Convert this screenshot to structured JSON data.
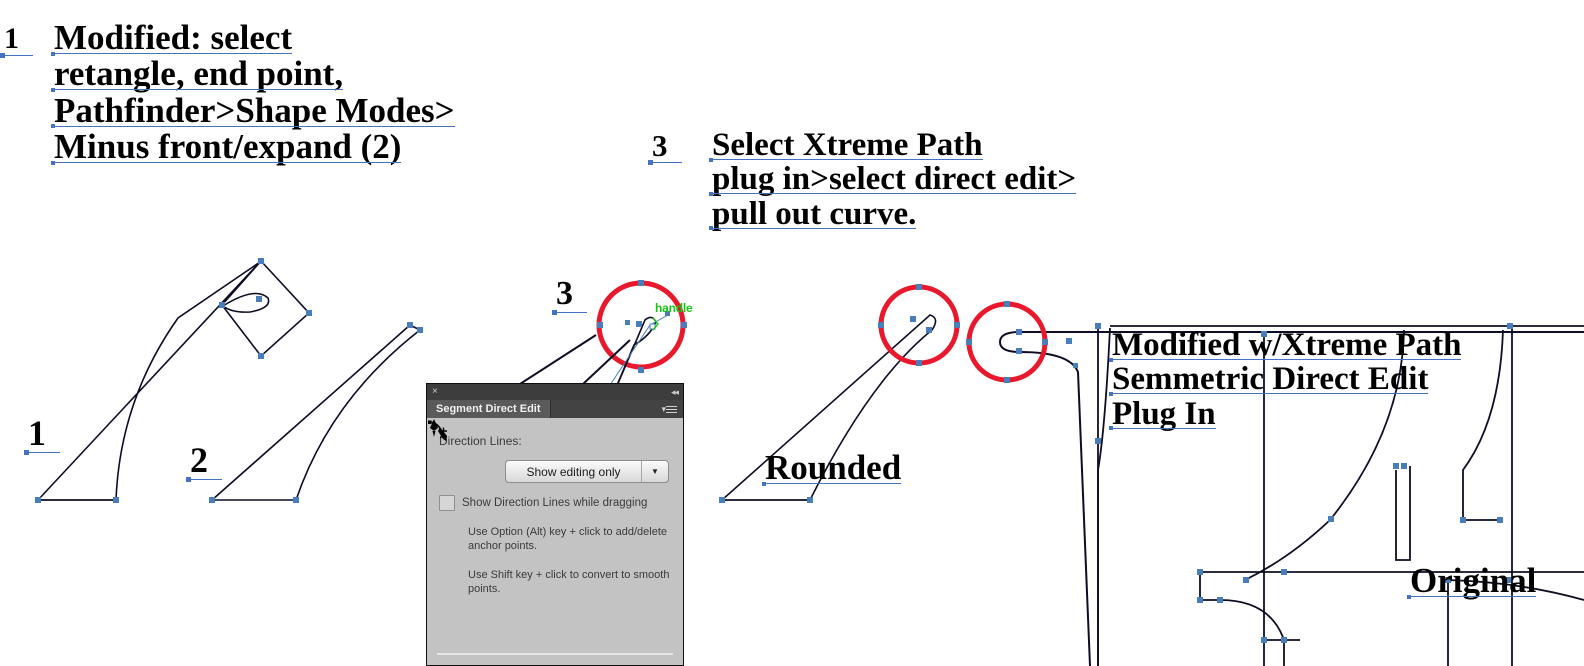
{
  "annotations": {
    "step1_marker": "1",
    "step1_lines": [
      "Modified: select",
      "retangle, end point,",
      "Pathfinder>Shape Modes>",
      "Minus front/expand (2)"
    ],
    "step3_marker": "3",
    "step3_lines": [
      "Select Xtreme Path",
      "plug in>select direct edit>",
      "pull out curve."
    ],
    "modified_lines": [
      "Modified w/Xtreme Path",
      "Semmetric Direct Edit",
      "Plug In"
    ],
    "shape1_label": "1",
    "shape2_label": "2",
    "circle3_label": "3",
    "rounded_label": "Rounded",
    "original_label": "Original",
    "handle_label": "handle"
  },
  "panel": {
    "title": "Segment Direct Edit",
    "close_icon": "×",
    "collapse_icon": "◂◂",
    "menu_icon": "▾",
    "direction_lines_label": "Direction Lines:",
    "dropdown_value": "Show editing only",
    "dropdown_arrow": "▼",
    "checkbox_label": "Show Direction Lines while dragging",
    "checkbox_checked": false,
    "tips": [
      {
        "icon": "add-anchor-point-tool-icon",
        "text": "Use Option (Alt) key + click to add/delete anchor points."
      },
      {
        "icon": "convert-anchor-point-tool-icon",
        "text": "Use Shift key + click to convert to smooth points."
      }
    ]
  },
  "colors": {
    "underline": "#4472c4",
    "anchor": "#4a7ebb",
    "highlight_circle": "#e8192c",
    "path_stroke": "#0d0d26",
    "handle_text": "#19c419",
    "panel_body": "#c3c3c3",
    "panel_titlebar": "#3d3d3d",
    "panel_tabbar": "#434343",
    "tab_active": "#5a5a5a"
  }
}
